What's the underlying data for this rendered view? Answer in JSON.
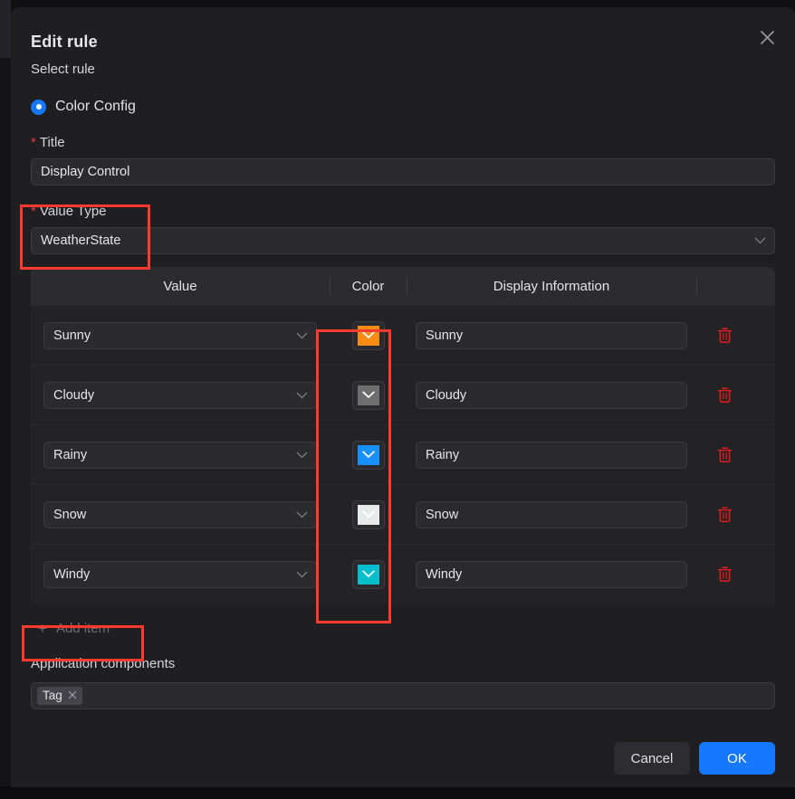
{
  "dialog": {
    "title": "Edit rule",
    "close_icon": "close-icon"
  },
  "form": {
    "select_rule_label": "Select rule",
    "rule_option": {
      "label": "Color Config",
      "selected": true
    },
    "title_field": {
      "label": "Title",
      "required_marker": "*",
      "value": "Display Control"
    },
    "value_type_field": {
      "label": "Value Type",
      "required_marker": "*",
      "value": "WeatherState",
      "caret_icon": "chevron-down-icon"
    }
  },
  "table": {
    "columns": [
      "Value",
      "Color",
      "Display Information",
      ""
    ],
    "rows": [
      {
        "value": "Sunny",
        "color": "#FA8C16",
        "display": "Sunny",
        "delete_icon": "trash-icon"
      },
      {
        "value": "Cloudy",
        "color": "#6E6E6E",
        "display": "Cloudy",
        "delete_icon": "trash-icon"
      },
      {
        "value": "Rainy",
        "color": "#1890FF",
        "display": "Rainy",
        "delete_icon": "trash-icon"
      },
      {
        "value": "Snow",
        "color": "#E6EAE9",
        "display": "Snow",
        "delete_icon": "trash-icon"
      },
      {
        "value": "Windy",
        "color": "#00BFCC",
        "display": "Windy",
        "delete_icon": "trash-icon"
      }
    ]
  },
  "add_item": {
    "label": "Add item",
    "plus_icon": "plus-icon"
  },
  "application_components": {
    "label": "Application components",
    "tags": [
      {
        "label": "Tag",
        "remove_icon": "close-icon"
      }
    ]
  },
  "footer": {
    "cancel_label": "Cancel",
    "ok_label": "OK"
  },
  "annotations": {
    "color": "#FF3B30",
    "boxes": [
      "value-type-field",
      "color-column",
      "add-item-button"
    ]
  }
}
